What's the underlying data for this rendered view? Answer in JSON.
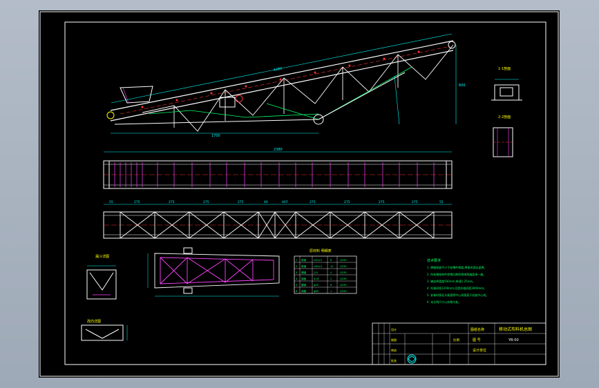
{
  "drawing": {
    "overall_length": "2380",
    "top_length": "4280",
    "height_dim": "600",
    "base_span": "1700",
    "truss_panels": [
      "55",
      "275",
      "275",
      "275",
      "275",
      "40",
      "407",
      "275",
      "275",
      "275",
      "275",
      "55"
    ],
    "views": {
      "section_a": "1-1剖面",
      "section_b": "2-2剖面",
      "hopper": "漏斗详图",
      "roller": "改向详图"
    },
    "table": {
      "title": "原材料 明细表",
      "rows": [
        [
          "1",
          "角钢",
          "L50×5",
          "8",
          "Q235"
        ],
        [
          "2",
          "角钢",
          "L40×4",
          "12",
          "Q235"
        ],
        [
          "3",
          "槽钢",
          "[10",
          "4",
          "Q235"
        ],
        [
          "4",
          "钢板",
          "δ=8",
          "2",
          "Q235"
        ],
        [
          "5",
          "圆钢",
          "φ20",
          "6",
          "Q235"
        ],
        [
          "6",
          "钢管",
          "φ89",
          "1",
          "Q235"
        ]
      ]
    },
    "notes_title": "技术要求",
    "notes": [
      "1. 焊缝高度不小于较薄件厚度,焊接牢固无虚焊。",
      "2. 所有钢结构件除锈后刷防锈漆两遍面漆一遍。",
      "3. 输送带宽度500mm,带速1.25m/s。",
      "4. 托辊间距1200mm,回程托辊间距3000mm。",
      "5. 安装时保证头尾滚筒中心线垂直于机架中心线。",
      "6. 未注明尺寸以实物为准。"
    ]
  },
  "title_block": {
    "project_label": "图纸名称",
    "title": "移动式布料机总图",
    "drawing_no_label": "图 号",
    "drawing_no": "YB-00",
    "scale_label": "比例",
    "designer_label": "设计单位",
    "row_labels": [
      "设计",
      "制图",
      "审核",
      "批准"
    ]
  }
}
